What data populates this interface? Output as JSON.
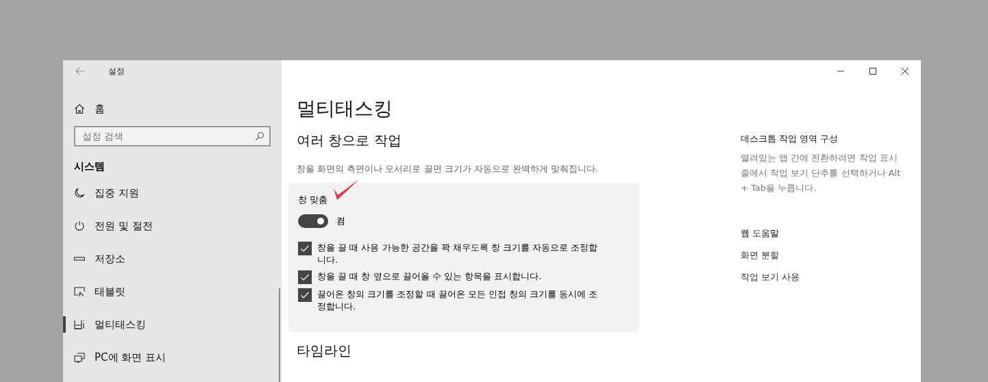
{
  "window": {
    "title": "설정"
  },
  "sidebar": {
    "home": "홈",
    "search": {
      "placeholder": "설정 검색"
    },
    "section": "시스템",
    "items": [
      {
        "label": "집중 지원",
        "selected": false
      },
      {
        "label": "전원 및 절전",
        "selected": false
      },
      {
        "label": "저장소",
        "selected": false
      },
      {
        "label": "태블릿",
        "selected": false
      },
      {
        "label": "멀티태스킹",
        "selected": true
      },
      {
        "label": "PC에 화면 표시",
        "selected": false
      }
    ]
  },
  "main": {
    "title": "멀티태스킹",
    "section": "여러 창으로 작업",
    "description": "창을 화면의 측면이나 모서리로 끌면 크기가 자동으로 완벽하게 맞춰집니다.",
    "card": {
      "title": "창 맞춤",
      "toggle": {
        "on": true,
        "label": "켬"
      },
      "options": [
        {
          "label": "창을 끌 때 사용 가능한 공간을 꽉 채우도록 창 크기를 자동으로 조정합니다.",
          "checked": true
        },
        {
          "label": "창을 끌 때 창 옆으로 끌어올 수 있는 항목을 표시합니다.",
          "checked": true
        },
        {
          "label": "끌어온 창의 크기를 조정할 때 끌어온 모든 인접 창의 크기를 동시에 조정합니다.",
          "checked": true
        }
      ]
    },
    "next_section": "타임라인"
  },
  "related": {
    "heading": "데스크톱 작업 영역 구성",
    "text": "열려있는 앱 간에 전환하려면 작업 표시줄에서 작업 보기 단추를 선택하거나 Alt + Tab을 누릅니다.",
    "help_heading": "웹 도움말",
    "links": [
      "화면 분할",
      "작업 보기 사용"
    ]
  }
}
